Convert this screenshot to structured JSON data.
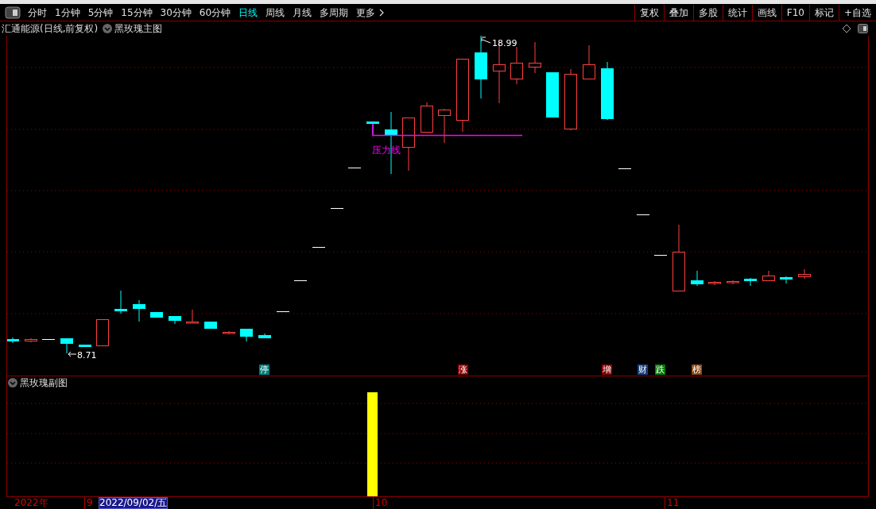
{
  "toolbar": {
    "tabs": [
      {
        "label": "分时",
        "selected": false
      },
      {
        "label": "1分钟",
        "selected": false
      },
      {
        "label": "5分钟",
        "selected": false
      },
      {
        "label": "15分钟",
        "selected": false
      },
      {
        "label": "30分钟",
        "selected": false
      },
      {
        "label": "60分钟",
        "selected": false
      },
      {
        "label": "日线",
        "selected": true
      },
      {
        "label": "周线",
        "selected": false
      },
      {
        "label": "月线",
        "selected": false
      },
      {
        "label": "多周期",
        "selected": false
      },
      {
        "label": "更多",
        "selected": false
      }
    ],
    "buttons": [
      "复权",
      "叠加",
      "多股",
      "统计",
      "画线",
      "F10",
      "标记",
      "+自选"
    ]
  },
  "chart_header": {
    "title": "汇通能源(日线,前复权)",
    "indicator": "黑玫瑰主图"
  },
  "main_chart": {
    "high_label": "18.99",
    "low_label": "8.71",
    "line_label": "压力线",
    "markers": [
      {
        "label": "停",
        "color": "#007b7b"
      },
      {
        "label": "涨",
        "color": "#8b0000"
      },
      {
        "label": "增",
        "color": "#8b0000"
      },
      {
        "label": "财",
        "color": "#1c3f7a"
      },
      {
        "label": "跌",
        "color": "#007a00"
      },
      {
        "label": "榜",
        "color": "#8b4513"
      }
    ]
  },
  "sub_chart": {
    "title": "黑玫瑰副图"
  },
  "time_axis": {
    "year": "2022年",
    "months": [
      "9",
      "10",
      "11"
    ],
    "cursor_date": "2022/09/02/五"
  }
}
